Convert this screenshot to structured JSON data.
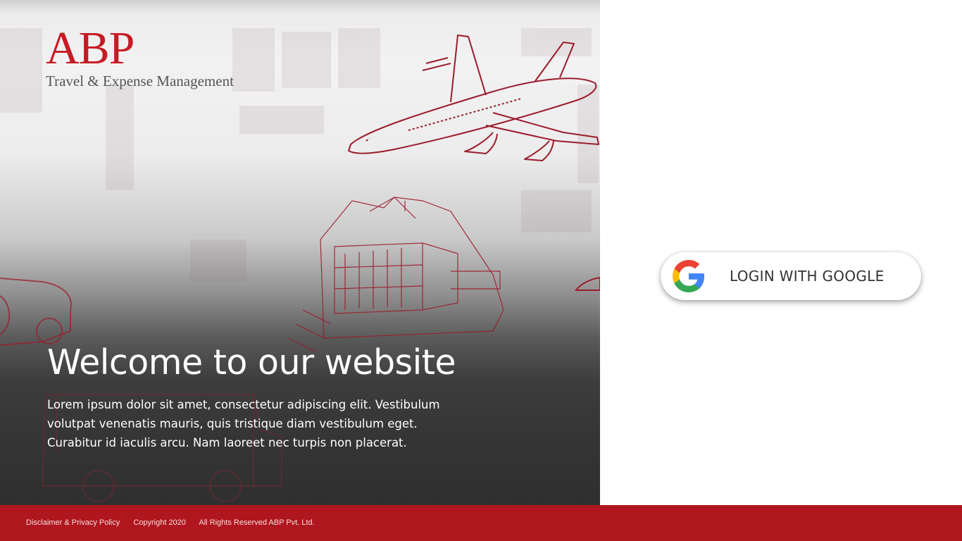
{
  "brand": {
    "logo": "ABP",
    "tagline": "Travel & Expense Management"
  },
  "hero": {
    "title": "Welcome to our website",
    "text": "Lorem ipsum dolor sit amet, consectetur adipiscing elit. Vestibulum volutpat venenatis mauris, quis tristique diam vestibulum eget. Curabitur id iaculis arcu. Nam laoreet nec turpis non placerat."
  },
  "login": {
    "google_label": "LOGIN WITH GOOGLE",
    "icon": "google-g-icon"
  },
  "footer": {
    "disclaimer_link": "Disclaimer & Privacy Policy",
    "copyright": "Copyright 2020",
    "rights": "All Rights Reserved ABP Pvt. Ltd."
  },
  "colors": {
    "brand_red": "#c61b24",
    "footer_red": "#b0161e",
    "sketch_red": "#9b1c2c"
  }
}
